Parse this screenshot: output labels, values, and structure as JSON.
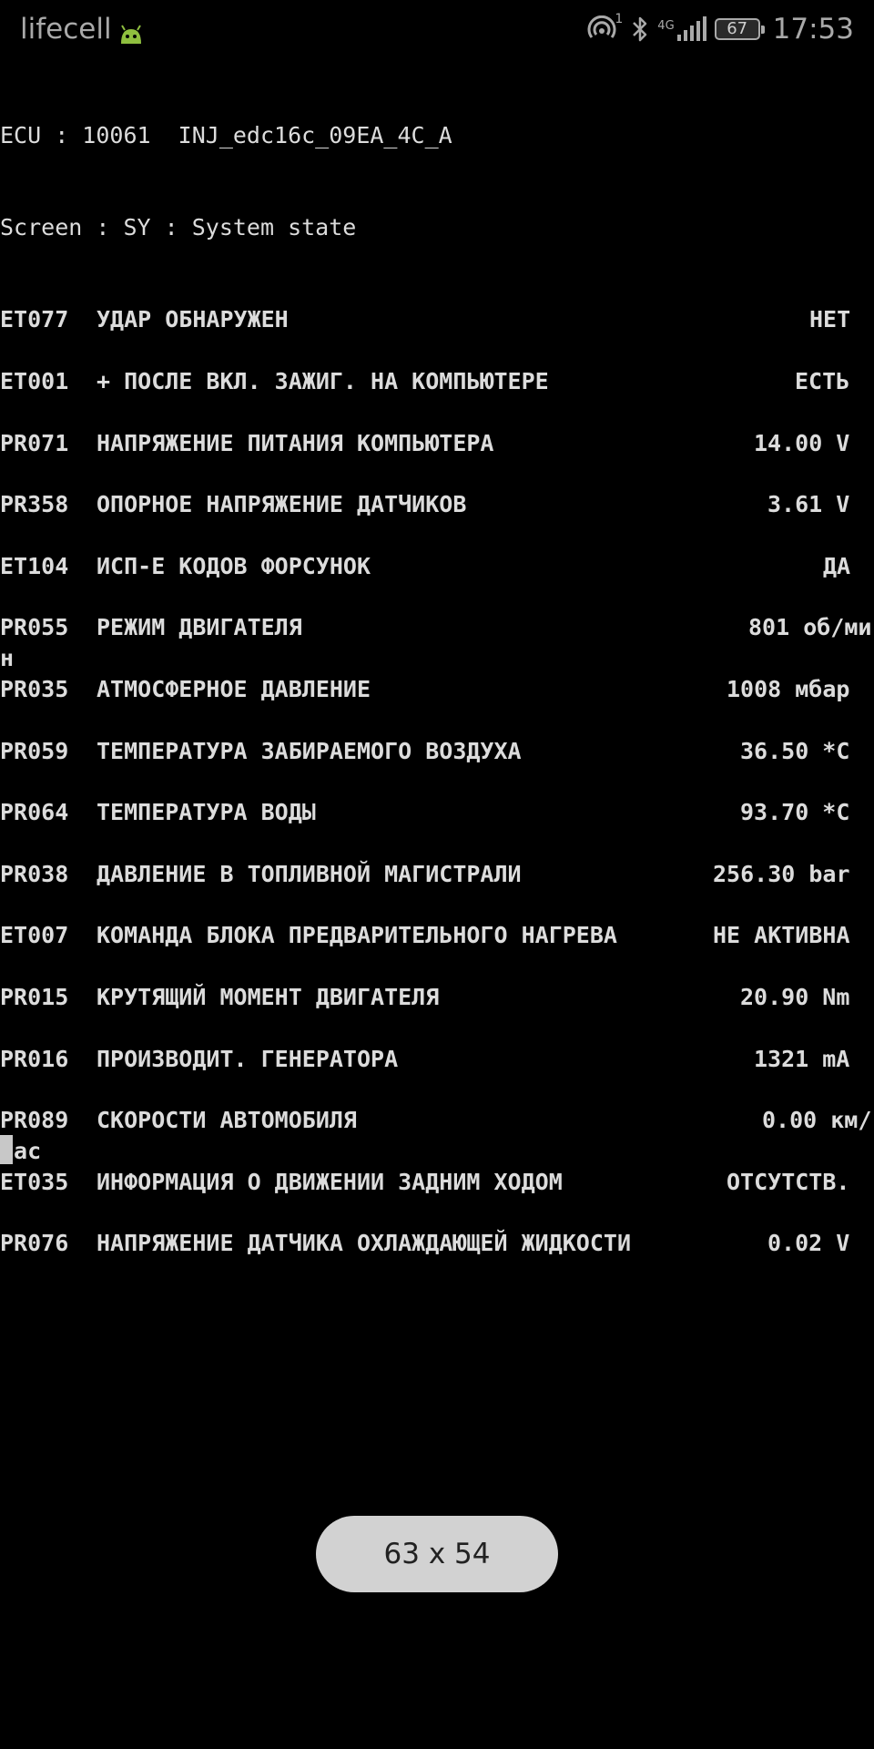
{
  "status_bar": {
    "carrier": "lifecell",
    "sim_slot": "1",
    "network": "4G",
    "battery": "67",
    "time": "17:53",
    "icons": [
      "android-notification-icon",
      "hotspot-icon",
      "bluetooth-icon",
      "signal-icon",
      "battery-icon"
    ]
  },
  "terminal": {
    "ecu_line": "ECU : 10061  INJ_edc16c_09EA_4C_A",
    "screen_line": "Screen : SY : System state",
    "rows": [
      {
        "code": "ET077",
        "label": "УДАР ОБНАРУЖЕН",
        "value": "НЕТ",
        "wrap": ""
      },
      {
        "code": "ET001",
        "label": "+ ПОСЛЕ ВКЛ. ЗАЖИГ. НА КОМПЬЮТЕРЕ",
        "value": "ЕСТЬ",
        "wrap": ""
      },
      {
        "code": "PR071",
        "label": "НАПРЯЖЕНИЕ ПИТАНИЯ КОМПЬЮТЕРА",
        "value": "14.00 V",
        "wrap": ""
      },
      {
        "code": "PR358",
        "label": "ОПОРНОЕ НАПРЯЖЕНИЕ ДАТЧИКОВ",
        "value": "3.61 V",
        "wrap": ""
      },
      {
        "code": "ET104",
        "label": "ИСП-Е КОДОВ ФОРСУНОК",
        "value": "ДА",
        "wrap": ""
      },
      {
        "code": "PR055",
        "label": "РЕЖИМ ДВИГАТЕЛЯ",
        "value": "801 об/ми",
        "wrap": "н"
      },
      {
        "code": "PR035",
        "label": "АТМОСФЕРНОЕ ДАВЛЕНИЕ",
        "value": "1008 мбар",
        "wrap": ""
      },
      {
        "code": "PR059",
        "label": "ТЕМПЕРАТУРА ЗАБИРАЕМОГО ВОЗДУХА",
        "value": "36.50 *C",
        "wrap": ""
      },
      {
        "code": "PR064",
        "label": "ТЕМПЕРАТУРА ВОДЫ",
        "value": "93.70 *C",
        "wrap": ""
      },
      {
        "code": "PR038",
        "label": "ДАВЛЕНИЕ В ТОПЛИВНОЙ МАГИСТРАЛИ",
        "value": "256.30 bar",
        "wrap": ""
      },
      {
        "code": "ET007",
        "label": "КОМАНДА БЛОКА ПРЕДВАРИТЕЛЬНОГО НАГРЕВА",
        "value": "НЕ АКТИВНА",
        "wrap": ""
      },
      {
        "code": "PR015",
        "label": "КРУТЯЩИЙ МОМЕНТ ДВИГАТЕЛЯ",
        "value": "20.90 Nm",
        "wrap": ""
      },
      {
        "code": "PR016",
        "label": "ПРОИЗВОДИТ. ГЕНЕРАТОРА",
        "value": "1321 mA",
        "wrap": ""
      },
      {
        "code": "PR089",
        "label": "СКОРОСТИ АВТОМОБИЛЯ",
        "value": "0.00 км/",
        "wrap": "час"
      },
      {
        "code": "ET035",
        "label": "ИНФОРМАЦИЯ О ДВИЖЕНИИ ЗАДНИМ ХОДОМ",
        "value": "ОТСУТСТВ.",
        "wrap": ""
      },
      {
        "code": "PR076",
        "label": "НАПРЯЖЕНИЕ ДАТЧИКА ОХЛАЖДАЮЩЕЙ ЖИДКОСТИ",
        "value": "0.02 V",
        "wrap": ""
      }
    ]
  },
  "toast": {
    "text": "63 x 54"
  }
}
